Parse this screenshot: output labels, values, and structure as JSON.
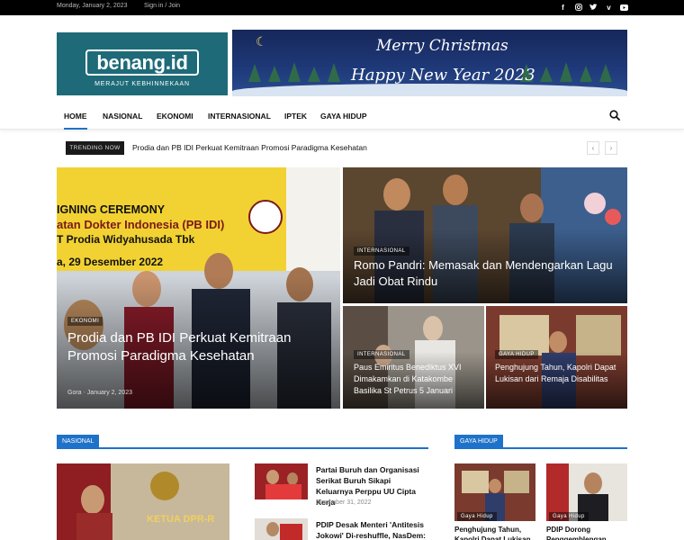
{
  "topbar": {
    "date": "Monday, January 2, 2023",
    "signin": "Sign in / Join",
    "social_icons": [
      "facebook-icon",
      "instagram-icon",
      "twitter-icon",
      "vimeo-icon",
      "youtube-icon"
    ]
  },
  "logo": {
    "name": "benang.id",
    "tagline": "MERAJUT KEBHINNEKAAN"
  },
  "banner": {
    "line1": "Merry Christmas",
    "line2": "Happy New Year 2023"
  },
  "nav": {
    "items": [
      "HOME",
      "NASIONAL",
      "EKONOMI",
      "INTERNASIONAL",
      "IPTEK",
      "GAYA HIDUP"
    ],
    "active": "HOME"
  },
  "trending": {
    "badge": "TRENDING NOW",
    "title": "Prodia dan PB IDI Perkuat Kemitraan Promosi Paradigma Kesehatan"
  },
  "featured": {
    "main": {
      "photo_caption": {
        "l1": "IGNING CEREMONY",
        "l2": "atan Dokter Indonesia (PB IDI)",
        "l3": "T Prodia Widyahusada Tbk",
        "l4": "a, 29 Desember 2022"
      },
      "category": "EKONOMI",
      "title": "Prodia dan PB IDI Perkuat Kemitraan Promosi Paradigma Kesehatan",
      "author": "Gora",
      "date": "January 2, 2023"
    },
    "top_right": {
      "category": "INTERNASIONAL",
      "title": "Romo Pandri: Memasak dan Mendengarkan Lagu Jadi Obat Rindu"
    },
    "bottom_left": {
      "category": "INTERNASIONAL",
      "title": "Paus Emiritus Benediktus XVI Dimakamkan di Katakombe Basilika St Petrus 5 Januari"
    },
    "bottom_right": {
      "category": "GAYA HIDUP",
      "title": "Penghujung Tahun, Kapolri Dapat Lukisan dari Remaja Disabilitas"
    }
  },
  "nasional": {
    "label": "NASIONAL",
    "photo_text": "KETUA DPR-R",
    "items": [
      {
        "title": "Partai Buruh dan Organisasi Serikat Buruh Sikapi Keluarnya Perppu UU Cipta Kerja",
        "date": "December 31, 2022"
      },
      {
        "title": "PDIP Desak Menteri 'Antitesis Jokowi' Di-reshuffle, NasDem:"
      }
    ]
  },
  "gaya_hidup": {
    "label": "GAYA HIDUP",
    "items": [
      {
        "category": "Gaya Hidup",
        "title": "Penghujung Tahun, Kapolri Dapat Lukisan dari"
      },
      {
        "category": "Gaya Hidup",
        "title": "PDIP Dorong Penggemblengan"
      }
    ]
  },
  "colors": {
    "accent": "#1f72c9",
    "logo_bg": "#1e6a78",
    "topbar_bg": "#000000"
  }
}
